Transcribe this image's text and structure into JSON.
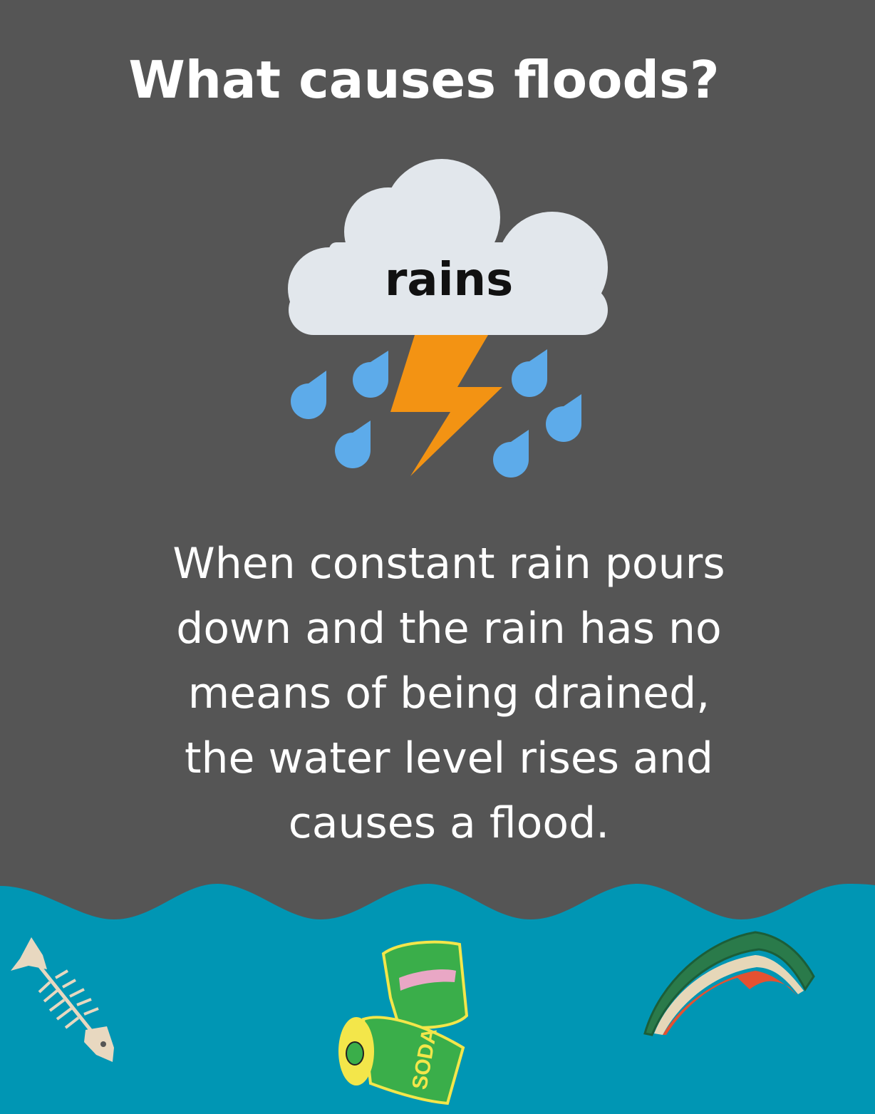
{
  "title": "What causes floods?",
  "cloud": {
    "label": "rains",
    "icon": "storm-cloud-icon"
  },
  "description": {
    "lines": [
      "When constant rain pours",
      "down and the rain has no",
      "means of being drained,",
      "the water level rises and",
      "causes a flood."
    ]
  },
  "debris": {
    "can_label": "SODA",
    "items": [
      "fish-bone-icon",
      "soda-can-icon",
      "watermelon-rind-icon"
    ]
  },
  "colors": {
    "background": "#555555",
    "water": "#0096b4",
    "cloud": "#e2e7ec",
    "bolt": "#f39313",
    "drops": "#5dabea"
  }
}
